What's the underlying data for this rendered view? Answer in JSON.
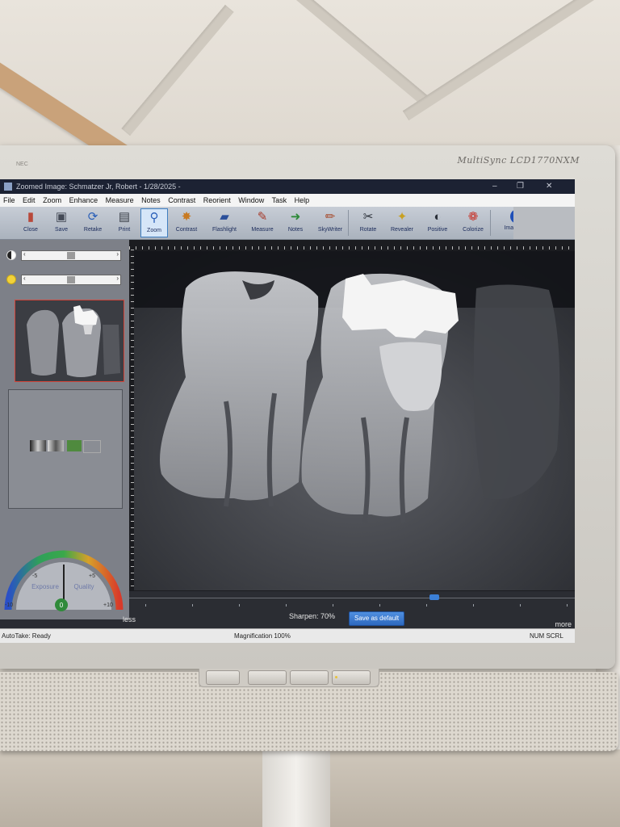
{
  "window": {
    "title": "Zoomed Image: Schmatzer Jr, Robert - 1/28/2025 -",
    "controls": [
      "–",
      "❐",
      "✕"
    ]
  },
  "monitor": {
    "brand": "MultiSync LCD1770NXM",
    "brand_left": "NEC"
  },
  "menu": [
    "File",
    "Edit",
    "Zoom",
    "Enhance",
    "Measure",
    "Notes",
    "Contrast",
    "Reorient",
    "Window",
    "Task",
    "Help"
  ],
  "toolbar": [
    {
      "label": "Close",
      "icon": "close-doc-icon",
      "glyph": "▮",
      "color": "#b8483a"
    },
    {
      "label": "Save",
      "icon": "floppy-icon",
      "glyph": "▣",
      "color": "#444a56"
    },
    {
      "label": "Retake",
      "icon": "refresh-icon",
      "glyph": "⟳",
      "color": "#2a5fb8"
    },
    {
      "label": "Print",
      "icon": "printer-icon",
      "glyph": "▤",
      "color": "#3a3f48"
    },
    {
      "label": "Zoom",
      "icon": "magnifier-icon",
      "glyph": "⚲",
      "color": "#2a5fb8",
      "active": true
    },
    {
      "label": "Contrast",
      "icon": "starburst-icon",
      "glyph": "✸",
      "color": "#c87a22"
    },
    {
      "label": "Flashlight",
      "icon": "flashlight-icon",
      "glyph": "▰",
      "color": "#2a4f9a"
    },
    {
      "label": "Measure",
      "icon": "ruler-pen-icon",
      "glyph": "✎",
      "color": "#a63a2a"
    },
    {
      "label": "Notes",
      "icon": "notes-arrow-icon",
      "glyph": "➜",
      "color": "#2f8a3a"
    },
    {
      "label": "SkyWriter",
      "icon": "pencil-icon",
      "glyph": "✏",
      "color": "#a6492a"
    },
    {
      "label": "Rotate",
      "icon": "rotate-icon",
      "glyph": "✂",
      "color": "#2a2f38"
    },
    {
      "label": "Revealer",
      "icon": "wand-icon",
      "glyph": "✦",
      "color": "#c8a022"
    },
    {
      "label": "Positive",
      "icon": "positive-icon",
      "glyph": "◐",
      "color": "#2a2f38"
    },
    {
      "label": "Colorize",
      "icon": "colorize-icon",
      "glyph": "❁",
      "color": "#c8342a"
    },
    {
      "label": "Image Info",
      "icon": "info-icon",
      "glyph": "ℹ",
      "color": "#ffffff"
    }
  ],
  "gauge": {
    "exposure_label": "Exposure",
    "quality_label": "Quality",
    "value": "0",
    "left_min": "-10",
    "left_mid": "-5",
    "right_mid": "+5",
    "right_max": "+10"
  },
  "sharpen": {
    "label": "Sharpen: 70%",
    "value_percent": 70,
    "save_button": "Save as default",
    "less": "less",
    "more": "more"
  },
  "status": {
    "left": "AutoTake: Ready",
    "center": "Magnification 100%",
    "right": "NUM  SCRL"
  },
  "colors": {
    "titlebar": "#1c2233",
    "active_tool_border": "#3f7ec0",
    "thumbnail_border": "#d2453a",
    "save_button": "#2e69bf"
  }
}
